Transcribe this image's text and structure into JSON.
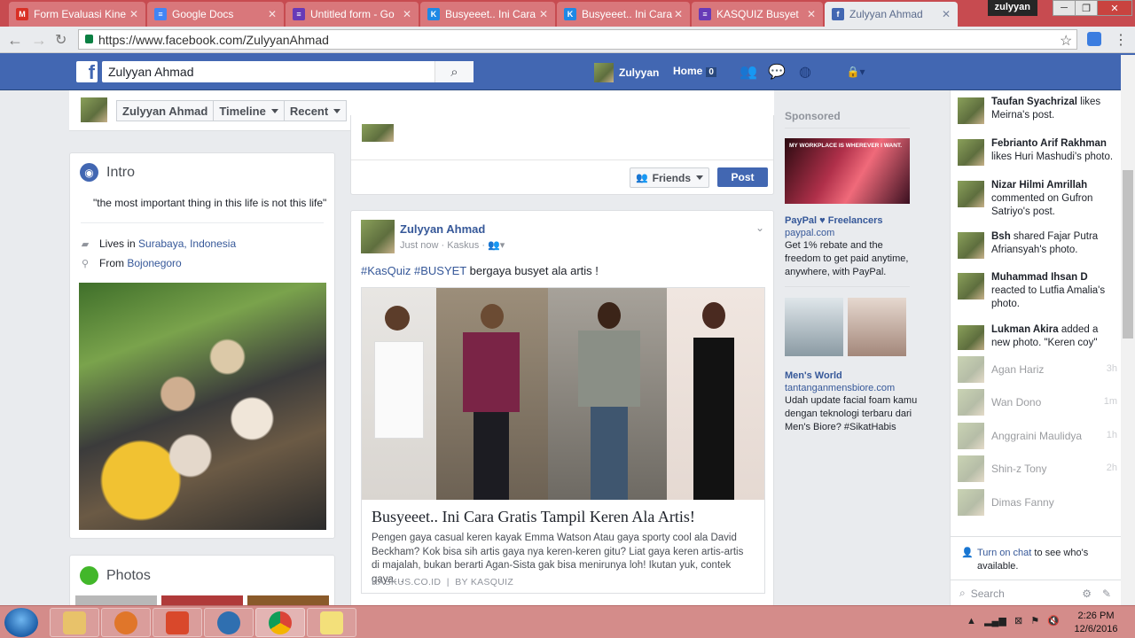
{
  "browser": {
    "tabs": [
      {
        "title": "Form Evaluasi Kine",
        "icon": "gmail-icon",
        "color": "#d93025"
      },
      {
        "title": "Google Docs",
        "icon": "docs-icon",
        "color": "#4285f4"
      },
      {
        "title": "Untitled form - Go",
        "icon": "forms-icon",
        "color": "#673ab7"
      },
      {
        "title": "Busyeeet.. Ini Cara",
        "icon": "kaskus-icon",
        "color": "#1e88e5"
      },
      {
        "title": "Busyeeet.. Ini Cara",
        "icon": "kaskus-icon",
        "color": "#1e88e5"
      },
      {
        "title": "KASQUIZ Busyet",
        "icon": "forms-icon",
        "color": "#673ab7"
      },
      {
        "title": "Zulyyan Ahmad",
        "icon": "facebook-icon",
        "color": "#4267b2",
        "active": true
      }
    ],
    "profile_name": "zulyyan",
    "url": "https://www.facebook.com/ZulyyanAhmad"
  },
  "fb_header": {
    "search_value": "Zulyyan Ahmad",
    "user_name": "Zulyyan",
    "home_label": "Home",
    "home_count": "0"
  },
  "profile_nav": {
    "name": "Zulyyan Ahmad",
    "timeline": "Timeline",
    "recent": "Recent"
  },
  "intro": {
    "title": "Intro",
    "quote": "\"the most important thing in this life is not this life\"",
    "lives_prefix": "Lives in ",
    "lives_city": "Surabaya, Indonesia",
    "from_prefix": "From ",
    "from_city": "Bojonegoro"
  },
  "photos": {
    "title": "Photos"
  },
  "composer": {
    "audience": "Friends",
    "post_label": "Post"
  },
  "post": {
    "author": "Zulyyan Ahmad",
    "time": "Just now",
    "via": "Kaskus",
    "hashtag1": "#KasQuiz",
    "hashtag2": "#BUSYET",
    "text": " bergaya busyet ala artis !",
    "link_title": "Busyeeet.. Ini Cara Gratis Tampil Keren Ala Artis!",
    "link_desc": "Pengen gaya casual keren kayak Emma Watson Atau gaya sporty cool ala David Beckham? Kok bisa sih artis gaya nya keren-keren gitu? Liat gaya keren artis-artis di majalah, bukan berarti Agan-Sista gak bisa menirunya loh! Ikutan yuk, contek gaya…",
    "link_source": "KASKUS.CO.ID",
    "link_by": "BY KASQUIZ"
  },
  "ads": {
    "sponsored": "Sponsored",
    "ad1": {
      "banner": "MY WORKPLACE IS WHEREVER I WANT.",
      "title": "PayPal ♥ Freelancers",
      "url": "paypal.com",
      "text": "Get 1% rebate and the freedom to get paid anytime, anywhere, with PayPal."
    },
    "ad2": {
      "title": "Men's World",
      "url": "tantanganmensbiore.com",
      "text": "Udah update facial foam kamu dengan teknologi terbaru dari Men's Biore? #SikatHabis"
    }
  },
  "ticker": [
    {
      "name": "Taufan Syachrizal",
      "action": " likes Meirna's post."
    },
    {
      "name": "Febrianto Arif Rakhman",
      "action": " likes Huri Mashudi's photo."
    },
    {
      "name": "Nizar Hilmi Amrillah",
      "action": " commented on Gufron Satriyo's post."
    },
    {
      "name": "Bsh",
      "action": " shared Fajar Putra Afriansyah's photo."
    },
    {
      "name": "Muhammad Ihsan D",
      "action": " reacted to Lutfia Amalia's photo."
    },
    {
      "name": "Lukman Akira",
      "action": " added a new photo. \"Keren coy\""
    }
  ],
  "chat": [
    {
      "name": "Agan Hariz",
      "time": "3h"
    },
    {
      "name": "Wan Dono",
      "time": "1m"
    },
    {
      "name": "Anggraini Maulidya",
      "time": "1h"
    },
    {
      "name": "Shin-z Tony",
      "time": "2h"
    },
    {
      "name": "Dimas Fanny",
      "time": ""
    }
  ],
  "chat_footer": {
    "turn_on": "Turn on chat",
    "rest": " to see who's available.",
    "search_placeholder": "Search"
  },
  "taskbar": {
    "time": "2:26 PM",
    "date": "12/6/2016"
  }
}
